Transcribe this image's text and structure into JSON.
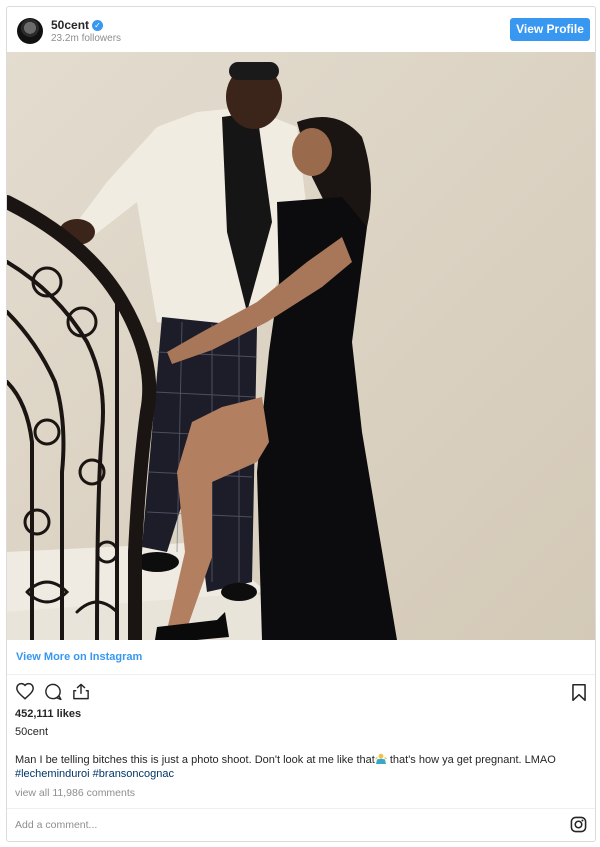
{
  "header": {
    "username": "50cent",
    "followers": "23.2m followers",
    "view_profile_label": "View Profile",
    "verified_badge_color": "#3897f0"
  },
  "photo": {
    "icon": "post-photo"
  },
  "links": {
    "view_more": "View More on Instagram"
  },
  "actions": {
    "icons": [
      "heart-icon",
      "comment-icon",
      "share-icon",
      "bookmark-icon"
    ]
  },
  "post": {
    "likes": "452,111 likes",
    "author": "50cent",
    "caption_text": "Man I be telling bitches this is just a photo shoot. Don't look at me like that",
    "caption_text_after": " that's how ya get pregnant. LMAO",
    "hashtags": [
      "#lecheminduroi",
      "#bransoncognac"
    ],
    "comments_link": "view all 11,986 comments",
    "add_comment_placeholder": "Add a comment...",
    "emoji_icon": "person-shrugging-emoji"
  },
  "colors": {
    "accent": "#3897f0",
    "hashtag": "#003569",
    "muted": "#8e8e8e"
  }
}
